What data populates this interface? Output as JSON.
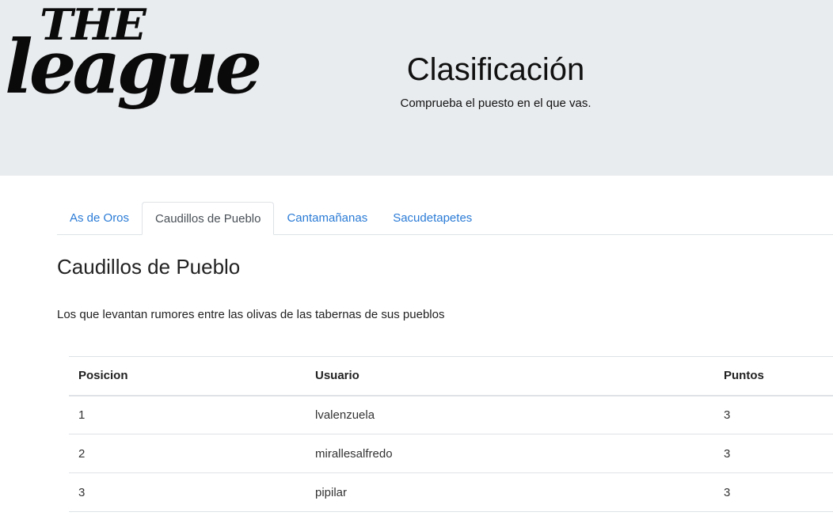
{
  "header": {
    "logo_line1": "THE",
    "logo_line2": "league",
    "title": "Clasificación",
    "subtitle": "Comprueba el puesto en el que vas."
  },
  "tabs": [
    {
      "label": "As de Oros",
      "active": false
    },
    {
      "label": "Caudillos de Pueblo",
      "active": true
    },
    {
      "label": "Cantamañanas",
      "active": false
    },
    {
      "label": "Sacudetapetes",
      "active": false
    }
  ],
  "section": {
    "title": "Caudillos de Pueblo",
    "description": "Los que levantan rumores entre las olivas de las tabernas de sus pueblos"
  },
  "table": {
    "headers": [
      "Posicion",
      "Usuario",
      "Puntos"
    ],
    "rows": [
      [
        "1",
        "lvalenzuela",
        "3"
      ],
      [
        "2",
        "mirallesalfredo",
        "3"
      ],
      [
        "3",
        "pipilar",
        "3"
      ]
    ]
  },
  "colors": {
    "header_bg": "#e9ecef",
    "link": "#2a7bd6",
    "border": "#dee2e6"
  }
}
